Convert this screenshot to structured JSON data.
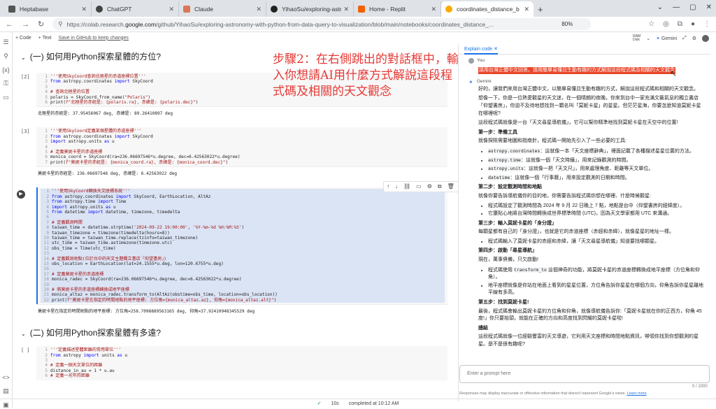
{
  "browser": {
    "tabs": [
      {
        "title": "Heptabase",
        "color": "#555555"
      },
      {
        "title": "ChatGPT",
        "color": "#444444"
      },
      {
        "title": "Claude",
        "color": "#d97757"
      },
      {
        "title": "YihaoSu/exploring-astro",
        "color": "#222222"
      },
      {
        "title": "Home - Replit",
        "color": "#f26207"
      },
      {
        "title": "coordinates_distance_b",
        "color": "#f9ab00"
      }
    ],
    "url_prefix": "https://colab.research.",
    "url_domain": "google.com",
    "url_rest": "/github/YihaoSu/exploring-astronomy-with-python-from-data-query-to-visualization/blob/main/notebooks/coordinates_distance_...",
    "zoom": "80%"
  },
  "colab": {
    "add_code": "+ Code",
    "add_text": "+ Text",
    "save_github": "Save in GitHub to keep changes",
    "ram": "RAM",
    "disk": "Disk",
    "gemini": "Gemini"
  },
  "notebook": {
    "heading1": "(一) 如何用Python探索星體的方位?",
    "heading2": "(二) 如何用Python探索星體有多遠?",
    "cell1_num": "[2]",
    "cell1_out": "北極星的赤經是: 37.95456067 deg, 赤緯是: 89.26410897 deg",
    "cell2_num": "[3]",
    "cell2_out": "莫妮卡星的赤經是:  236.06697546 deg, 赤緯是:  6.42563022 deg",
    "cell3_out": "莫妮卡星在指定的時間地點的地平座標: 方位角=258.7098889563165 deg, 仰角=37.92410948345529 deg",
    "cell4_num": "[ ]"
  },
  "annotation": "步驟2：在右側跳出的對話框中，輸入你想請AI用什麼方式解說這段程式碼及相關的天文觀念",
  "panel": {
    "tab": "Explain code",
    "you_label": "You",
    "user_message": "請用台灣正體中文回答。請用簡單易懂且生動有趣的方式解說這段程式碼及相關的天文觀念",
    "gemini_label": "Gemini",
    "p1": "好的，讓我們來用台灣正體中文，以簡單易懂且生動有趣的方式，解說這段程式碼和相關的天文觀念。",
    "p2": "想像一下，你是一位熱愛觀星的天文迷，在一個晴朗的夜晚，你來到台中一家充滿文藝氣息的獨立書店「仰望書房」，你迫不及待地想找到一顆名叫「莫妮卡星」的星星。但茫茫星海，你要怎麼知道莫妮卡星在哪裡呢?",
    "p3": "這段程式碼就像是一台「天文尋星導航儀」，它可以幫你精準地找到莫妮卡星在天空中的位置!",
    "s1": "第一步：準備工具",
    "s1p": "就像探險需要地圖和指南針，程式碼一開始先引入了一些必要的工具:",
    "s1l1a": "astropy.coordinates",
    "s1l1b": "：這就像一本「天文座標辭典」，裡面記載了各種描述星星位置的方法。",
    "s1l2a": "astropy.time",
    "s1l2b": "：這就像一個「天文時鐘」，用來記錄觀測的時間。",
    "s1l3a": "astropy.units",
    "s1l3b": "：這就像一把「天文尺」，用來處理角度、距離等天文單位。",
    "s1l4a": "datetime",
    "s1l4b": "：這就像一個「行事曆」，用來設定觀測的日期和時間。",
    "s2": "第二步：設定觀測時間和地點",
    "s2p": "就像你要告訴導航儀你的目的地，你需要告訴程式碼你想在哪裡、什麼時候觀星:",
    "s2l1": "程式碼設定了觀測時間為 2024 年 9 月 22 日晚上 7 點，地點是台中（仰望書房的經緯度）。",
    "s2l2": "它還貼心地將台灣時間轉換成世界標準時間 (UTC)，因為天文學家都用 UTC 來溝通。",
    "s3": "第三步：輸入莫妮卡星的「身分證」",
    "s3p": "每顆星都有自己的「身分證」，也就是它的赤道座標（赤經和赤緯），就像星星的地址一樣。",
    "s3l1": "程式碼輸入了莫妮卡星的赤經和赤緯，讓「天文尋星導航儀」知道要找哪顆星。",
    "s4": "第四步：啟動「尋星導航」",
    "s4p": "現在，萬事俱備，只欠啟動!",
    "s4l1a": "程式碼使用 ",
    "s4l1b": "transform_to",
    "s4l1c": " 這個神奇的功能，將莫妮卡星的赤道座標轉換成地平座標（方位角和仰角）。",
    "s4l2": "地平座標就像是你站在地面上看到的星星位置，方位角告訴你星星在哪個方向，仰角告訴你星星離地平線有多高。",
    "s5": "第五步：找到莫妮卡星!",
    "s5p": "最後，程式碼會輸出莫妮卡星的方位角和仰角，就像導航儀告訴你:「莫妮卡星就在你的正西方，仰角 45 度!」你只要抬頭，就能在正確的方向和高度找到閃耀的莫妮卡星啦!",
    "s6": "總結",
    "s6p": "這段程式碼就像一位經驗豐富的天文導遊，它利用天文座標和時間地點資訊，帶領你找到你想觀測的星星。是不是很有趣呢?",
    "prompt_placeholder": "Enter a prompt here",
    "counter": "0 / 1000",
    "disclaimer": "Responses may display inaccurate or offensive information that doesn't represent Google's views.",
    "learn_more": "Learn more"
  },
  "status": {
    "check": "✓",
    "duration": "10s",
    "completed": "completed at 10:12 AM"
  }
}
